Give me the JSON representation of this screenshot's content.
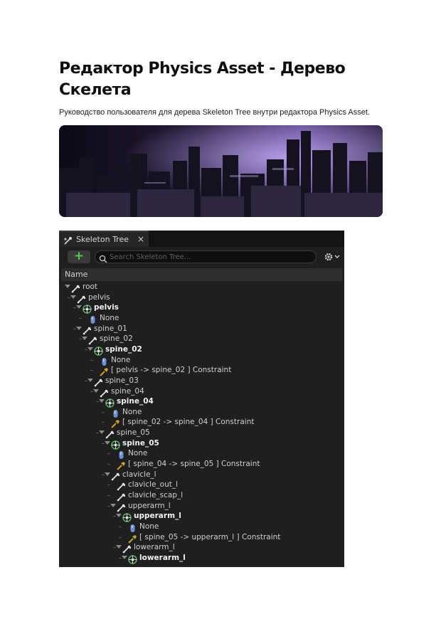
{
  "page": {
    "title": "Редактор Physics Asset - Дерево Скелета",
    "subtitle": "Руководство пользователя для дерева Skeleton Tree внутри редактора Physics Asset."
  },
  "panel": {
    "tab_label": "Skeleton Tree",
    "tab_close": "×",
    "add_label": "+",
    "search_placeholder": "Search Skeleton Tree...",
    "column_header": "Name"
  },
  "tree": [
    {
      "depth": 0,
      "type": "bone",
      "label": "root",
      "expander": true
    },
    {
      "depth": 1,
      "type": "bone",
      "label": "pelvis",
      "expander": true
    },
    {
      "depth": 2,
      "type": "body",
      "label": "pelvis",
      "expander": true
    },
    {
      "depth": 3,
      "type": "shape",
      "label": "None",
      "expander": false
    },
    {
      "depth": 2,
      "type": "bone",
      "label": "spine_01",
      "expander": true
    },
    {
      "depth": 3,
      "type": "bone",
      "label": "spine_02",
      "expander": true
    },
    {
      "depth": 4,
      "type": "body",
      "label": "spine_02",
      "expander": true
    },
    {
      "depth": 5,
      "type": "shape",
      "label": "None",
      "expander": false
    },
    {
      "depth": 5,
      "type": "constraint",
      "label": "[ pelvis -> spine_02 ] Constraint",
      "expander": false
    },
    {
      "depth": 4,
      "type": "bone",
      "label": "spine_03",
      "expander": true
    },
    {
      "depth": 5,
      "type": "bone",
      "label": "spine_04",
      "expander": true
    },
    {
      "depth": 6,
      "type": "body",
      "label": "spine_04",
      "expander": true
    },
    {
      "depth": 7,
      "type": "shape",
      "label": "None",
      "expander": false
    },
    {
      "depth": 7,
      "type": "constraint",
      "label": "[ spine_02 -> spine_04 ] Constraint",
      "expander": false
    },
    {
      "depth": 6,
      "type": "bone",
      "label": "spine_05",
      "expander": true
    },
    {
      "depth": 7,
      "type": "body",
      "label": "spine_05",
      "expander": true
    },
    {
      "depth": 8,
      "type": "shape",
      "label": "None",
      "expander": false
    },
    {
      "depth": 8,
      "type": "constraint",
      "label": "[ spine_04 -> spine_05 ] Constraint",
      "expander": false
    },
    {
      "depth": 7,
      "type": "bone",
      "label": "clavicle_l",
      "expander": true
    },
    {
      "depth": 8,
      "type": "bone",
      "label": "clavicle_out_l",
      "expander": false
    },
    {
      "depth": 8,
      "type": "bone",
      "label": "clavicle_scap_l",
      "expander": false
    },
    {
      "depth": 8,
      "type": "bone",
      "label": "upperarm_l",
      "expander": true
    },
    {
      "depth": 9,
      "type": "body",
      "label": "upperarm_l",
      "expander": true
    },
    {
      "depth": 10,
      "type": "shape",
      "label": "None",
      "expander": false
    },
    {
      "depth": 10,
      "type": "constraint",
      "label": "[ spine_05 -> upperarm_l ] Constraint",
      "expander": false
    },
    {
      "depth": 9,
      "type": "bone",
      "label": "lowerarm_l",
      "expander": true
    },
    {
      "depth": 10,
      "type": "body",
      "label": "lowerarm_l",
      "expander": true
    }
  ],
  "colors": {
    "panel_bg": "#1f1f1f",
    "add_green": "#59c456",
    "body_green": "#4fae5a",
    "constraint_gold": "#c9a227",
    "shape_blue": "#6d8fd6"
  }
}
